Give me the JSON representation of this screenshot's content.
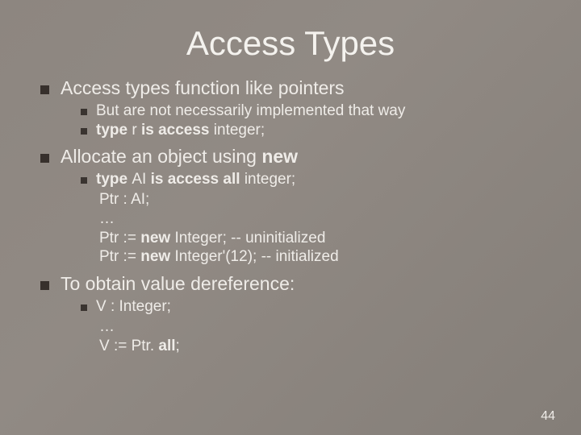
{
  "title": "Access Types",
  "b1": {
    "text": "Access types function like pointers",
    "sub1": "But are not necessarily implemented that way",
    "sub2_pre": "type ",
    "sub2_r": "r",
    "sub2_mid": " is access ",
    "sub2_end": "integer;"
  },
  "b2": {
    "pre": "Allocate an object using ",
    "kw": "new",
    "sub_pre": "type ",
    "sub_ai": "AI",
    "sub_mid": " is access all ",
    "sub_end": "integer;",
    "code1": "Ptr : AI;",
    "code2": "…",
    "code3_pre": "Ptr := ",
    "code3_new": "new ",
    "code3_rest": "Integer;  -- uninitialized",
    "code4_pre": "Ptr := ",
    "code4_new": "new ",
    "code4_rest": "Integer'(12);     -- initialized"
  },
  "b3": {
    "text": "To obtain value dereference:",
    "sub": "V : Integer;",
    "code1": "…",
    "code2_pre": "V := Ptr. ",
    "code2_all": "all",
    "code2_end": ";"
  },
  "page": "44"
}
